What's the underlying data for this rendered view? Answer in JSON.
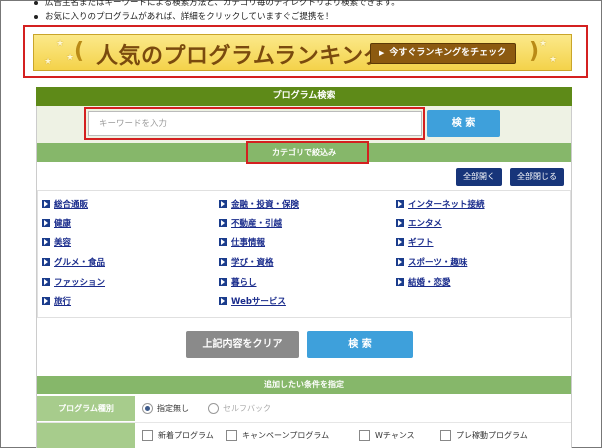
{
  "notes": [
    "広告主名またはキーワードによる検索方法と、カテゴリ毎のディレクトリより検索できます。",
    "お気に入りのプログラムがあれば、詳細をクリックしていますぐご提携を！"
  ],
  "banner": {
    "title": "人気のプログラムランキング",
    "button_label": "今すぐランキングをチェック"
  },
  "search": {
    "panel_title": "プログラム検索",
    "placeholder": "キーワードを入力",
    "search_label": "検 索"
  },
  "category": {
    "bar_title": "カテゴリで絞込み",
    "open_all": "全部開く",
    "close_all": "全部閉じる",
    "columns": [
      [
        "総合通販",
        "健康",
        "美容",
        "グルメ・食品",
        "ファッション",
        "旅行"
      ],
      [
        "金融・投資・保険",
        "不動産・引越",
        "仕事情報",
        "学び・資格",
        "暮らし",
        "Webサービス"
      ],
      [
        "インターネット接続",
        "エンタメ",
        "ギフト",
        "スポーツ・趣味",
        "結婚・恋愛"
      ]
    ]
  },
  "actions": {
    "clear_label": "上記内容をクリア",
    "search_label": "検 索"
  },
  "conditions": {
    "head": "追加したい条件を指定",
    "program_type_label": "プログラム種別",
    "type_options": [
      {
        "label": "指定無し",
        "selected": true
      },
      {
        "label": "セルフバック",
        "selected": false
      }
    ],
    "checkboxes": [
      "新着プログラム",
      "キャンペーンプログラム",
      "Wチャンス",
      "プレ稼動プログラム"
    ]
  },
  "colors": {
    "accent_red": "#d42020",
    "header_green": "#5e8a18",
    "bar_green": "#86b76a",
    "button_blue": "#3ea0db",
    "button_navy": "#17357a"
  }
}
